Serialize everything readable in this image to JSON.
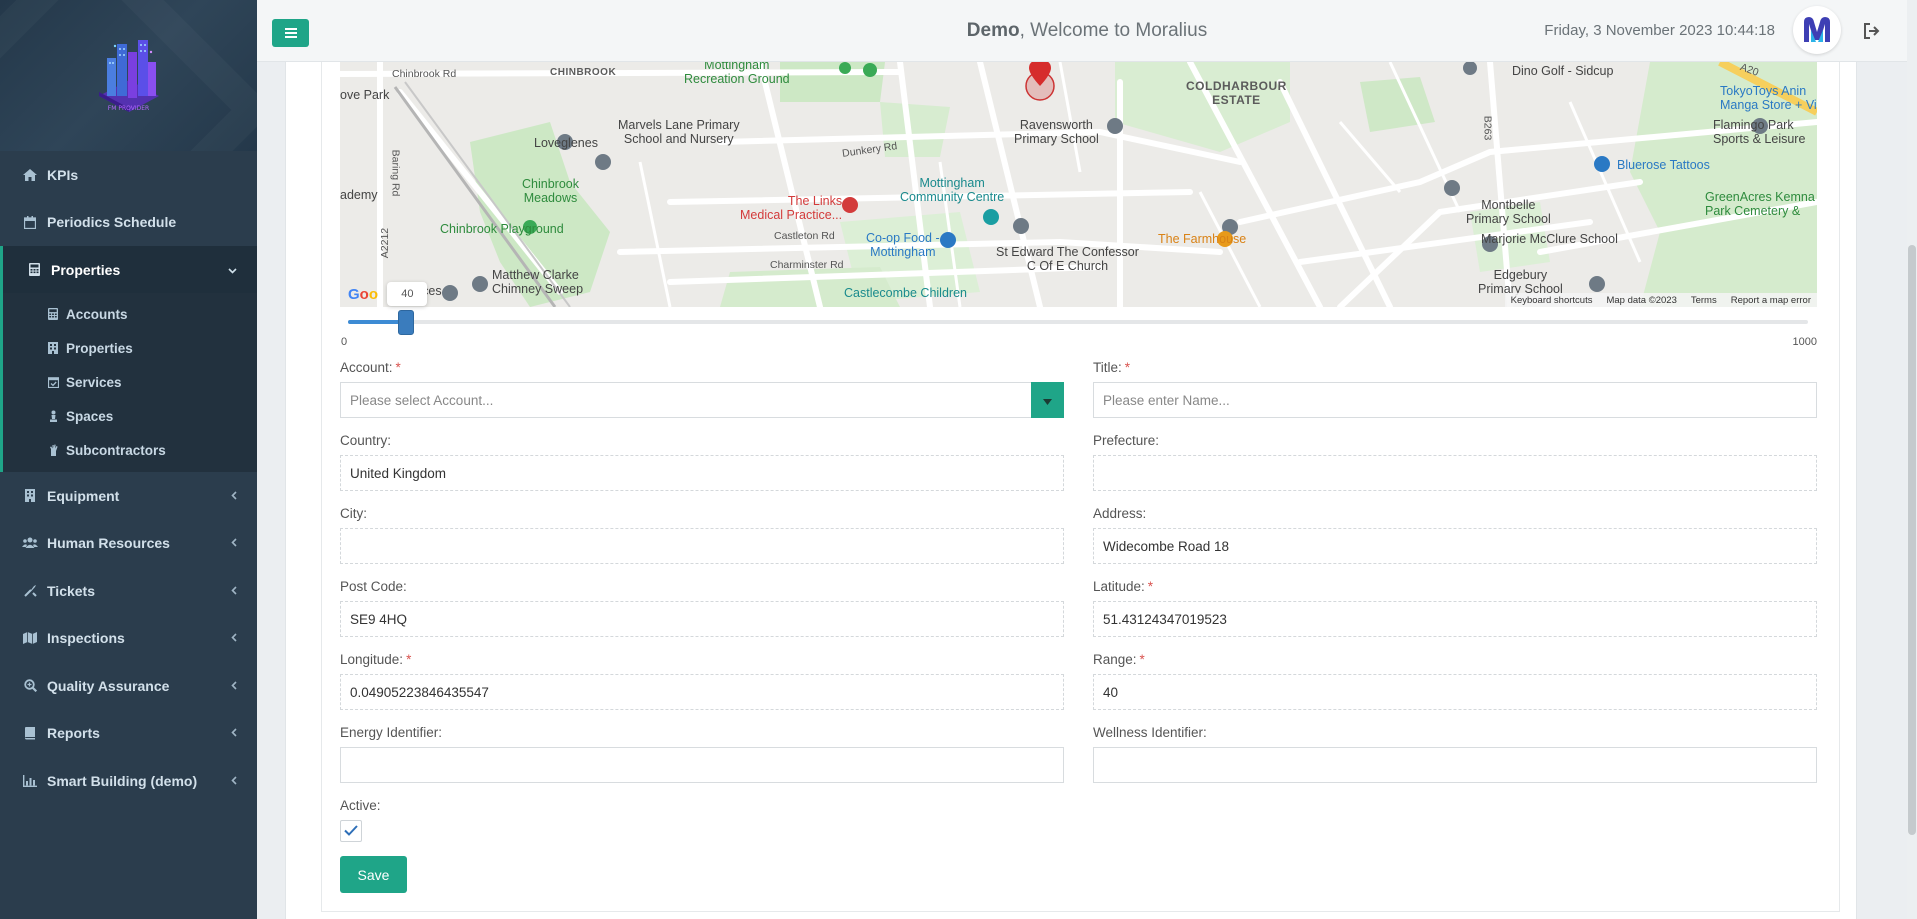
{
  "sidebar": {
    "logo_caption": "FM PROVIDER",
    "items": [
      {
        "label": "KPIs",
        "icon": "home-icon"
      },
      {
        "label": "Periodics Schedule",
        "icon": "calendar-icon"
      },
      {
        "label": "Properties",
        "icon": "calculator-icon",
        "expanded": true
      },
      {
        "label": "Equipment",
        "icon": "building-icon"
      },
      {
        "label": "Human Resources",
        "icon": "users-icon"
      },
      {
        "label": "Tickets",
        "icon": "tools-icon"
      },
      {
        "label": "Inspections",
        "icon": "map-icon"
      },
      {
        "label": "Quality Assurance",
        "icon": "search-plus-icon"
      },
      {
        "label": "Reports",
        "icon": "book-icon"
      },
      {
        "label": "Smart Building (demo)",
        "icon": "chart-icon"
      }
    ],
    "properties_sub": [
      {
        "label": "Accounts",
        "icon": "calculator-icon"
      },
      {
        "label": "Properties",
        "icon": "building-icon"
      },
      {
        "label": "Services",
        "icon": "calendar-check-icon"
      },
      {
        "label": "Spaces",
        "icon": "chess-icon"
      },
      {
        "label": "Subcontractors",
        "icon": "hand-icon"
      }
    ]
  },
  "header": {
    "title_bold": "Demo",
    "title_rest": ", Welcome to Moralius",
    "datetime": "Friday, 3 November 2023 10:44:18"
  },
  "map": {
    "labels": {
      "chinbrook_rd": "Chinbrook Rd",
      "chinbrook": "CHINBROOK",
      "mottingham_rg": "Mottingham\nRecreation Ground",
      "coldharbour": "COLDHARBOUR\nESTATE",
      "dino_golf": "Dino Golf - Sidcup",
      "tokyotoys": "TokyoToys Anin\nManga Store + Vide",
      "flamingo": "Flamingo Park\nSports & Leisure",
      "grove_park": "ove Park",
      "marvels": "Marvels Lane Primary\nSchool and Nursery",
      "ravensworth": "Ravensworth\nPrimary School",
      "loveglenes": "Loveglenes",
      "chinbrook_meadows": "Chinbrook\nMeadows",
      "links": "The Links\nMedical Practice...",
      "mottingham_cc": "Mottingham\nCommunity Centre",
      "bluerose": "Bluerose Tattoos",
      "greenacres": "GreenAcres Kemna\nPark Cemetery &",
      "academy": "ademy",
      "chinbrook_playground": "Chinbrook Playground",
      "coop": "Co-op Food -\nMottingham",
      "farmhouse": "The Farmhouse",
      "montbelle": "Montbelle\nPrimary School",
      "marjorie": "Marjorie McClure School",
      "st_edward": "St Edward The Confessor\nC Of E Church",
      "matthew": "Matthew Clarke\nChimney Sweep",
      "services": "ervices",
      "castlecombe": "Castlecombe Children",
      "edgebury": "Edgebury\nPrimary School",
      "dunkery": "Dunkery Rd",
      "castleton": "Castleton Rd",
      "charminster": "Charminster Rd",
      "a2212": "A2212",
      "b263": "B263",
      "a20": "A20",
      "baring": "Baring Rd"
    },
    "footer": [
      "Keyboard shortcuts",
      "Map data ©2023",
      "Terms",
      "Report a map error"
    ]
  },
  "slider": {
    "value": "40",
    "min": "0",
    "max": "1000",
    "fraction": 0.04
  },
  "form": {
    "account": {
      "label": "Account:",
      "placeholder": "Please select Account...",
      "required": true
    },
    "title": {
      "label": "Title:",
      "placeholder": "Please enter Name...",
      "required": true
    },
    "country": {
      "label": "Country:",
      "value": "United Kingdom"
    },
    "prefecture": {
      "label": "Prefecture:",
      "value": ""
    },
    "city": {
      "label": "City:",
      "value": ""
    },
    "address": {
      "label": "Address:",
      "value": "Widecombe Road 18"
    },
    "post_code": {
      "label": "Post Code:",
      "value": "SE9 4HQ"
    },
    "latitude": {
      "label": "Latitude:",
      "value": "51.43124347019523",
      "required": true
    },
    "longitude": {
      "label": "Longitude:",
      "value": "0.04905223846435547",
      "required": true
    },
    "range": {
      "label": "Range:",
      "value": "40",
      "required": true
    },
    "energy": {
      "label": "Energy Identifier:",
      "value": ""
    },
    "wellness": {
      "label": "Wellness Identifier:",
      "value": ""
    },
    "active": {
      "label": "Active:",
      "checked": true
    },
    "save_label": "Save",
    "required_mark": "*"
  },
  "colors": {
    "accent": "#1fa588",
    "sidebar": "#2b3d4d",
    "slider": "#3a7cbd"
  }
}
